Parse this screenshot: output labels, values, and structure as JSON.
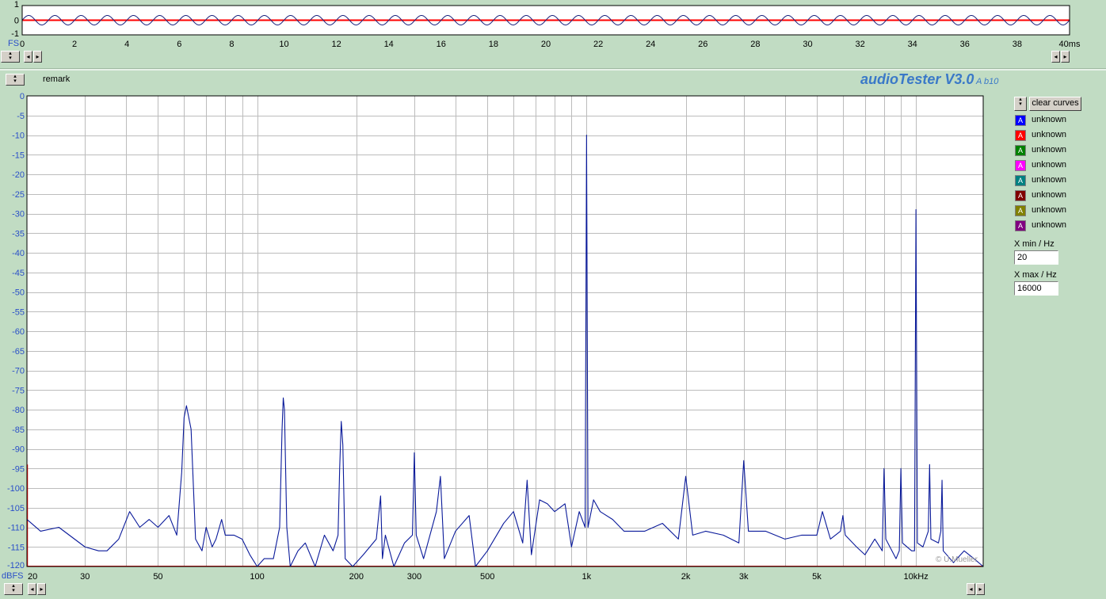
{
  "scope": {
    "y_ticks": [
      "1",
      "0",
      "-1"
    ],
    "y_unit": "FS",
    "x_ticks": [
      "0",
      "2",
      "4",
      "6",
      "8",
      "10",
      "12",
      "14",
      "16",
      "18",
      "20",
      "22",
      "24",
      "26",
      "28",
      "30",
      "32",
      "34",
      "36",
      "38",
      "40ms"
    ],
    "trace_color": "#1a237e",
    "zero_line_color": "#ff0000"
  },
  "header": {
    "remark": "remark",
    "app_title": "audioTester V3.0",
    "app_version": "A b10"
  },
  "spectrum": {
    "y_ticks": [
      "0",
      "-5",
      "-10",
      "-15",
      "-20",
      "-25",
      "-30",
      "-35",
      "-40",
      "-45",
      "-50",
      "-55",
      "-60",
      "-65",
      "-70",
      "-75",
      "-80",
      "-85",
      "-90",
      "-95",
      "-100",
      "-105",
      "-110",
      "-115",
      "-120"
    ],
    "y_unit": "dBFS",
    "x_ticks": [
      "20",
      "30",
      "50",
      "100",
      "200",
      "300",
      "500",
      "1k",
      "2k",
      "3k",
      "5k",
      "10kHz"
    ],
    "copyright": "© U.Mueller",
    "trace_color": "#0a1a9a"
  },
  "chart_data": {
    "type": "line",
    "title": "",
    "xlabel": "",
    "ylabel": "dBFS",
    "x_scale": "log",
    "xlim": [
      20,
      16000
    ],
    "ylim": [
      -120,
      0
    ],
    "grid": true,
    "series": [
      {
        "name": "unknown",
        "color": "#0a1a9a",
        "x": [
          20,
          22,
          25,
          30,
          33,
          35,
          38,
          41,
          44,
          47,
          50,
          54,
          57,
          59,
          60,
          61,
          63,
          65,
          68,
          70,
          73,
          75,
          78,
          80,
          85,
          90,
          95,
          100,
          105,
          112,
          117,
          119,
          120,
          121,
          123,
          126,
          133,
          140,
          150,
          160,
          170,
          176,
          178,
          180,
          182,
          185,
          195,
          210,
          230,
          237,
          240,
          245,
          260,
          280,
          296,
          300,
          304,
          320,
          350,
          360,
          370,
          400,
          440,
          460,
          500,
          560,
          600,
          640,
          660,
          680,
          720,
          760,
          800,
          860,
          900,
          950,
          990,
          1000,
          1010,
          1050,
          1100,
          1200,
          1300,
          1500,
          1700,
          1900,
          2000,
          2100,
          2300,
          2600,
          2900,
          3000,
          3100,
          3500,
          4000,
          4500,
          5000,
          5200,
          5500,
          5900,
          6000,
          6100,
          6600,
          7000,
          7500,
          7900,
          8000,
          8100,
          8700,
          8900,
          9000,
          9100,
          9700,
          9900,
          10000,
          10100,
          10500,
          10900,
          11000,
          11100,
          11700,
          11900,
          12000,
          12100,
          13000,
          14000,
          15000,
          16000
        ],
        "y": [
          -108,
          -111,
          -110,
          -115,
          -116,
          -116,
          -113,
          -106,
          -110,
          -108,
          -110,
          -107,
          -112,
          -96,
          -82,
          -79,
          -85,
          -113,
          -116,
          -110,
          -115,
          -113,
          -108,
          -112,
          -112,
          -113,
          -117,
          -120,
          -118,
          -118,
          -110,
          -85,
          -77,
          -80,
          -110,
          -120,
          -116,
          -114,
          -120,
          -112,
          -116,
          -112,
          -95,
          -83,
          -89,
          -118,
          -120,
          -117,
          -113,
          -102,
          -118,
          -112,
          -120,
          -114,
          -112,
          -91,
          -112,
          -118,
          -106,
          -97,
          -118,
          -111,
          -107,
          -120,
          -116,
          -109,
          -106,
          -114,
          -98,
          -117,
          -103,
          -104,
          -106,
          -104,
          -115,
          -106,
          -110,
          -10,
          -110,
          -103,
          -106,
          -108,
          -111,
          -111,
          -109,
          -113,
          -97,
          -112,
          -111,
          -112,
          -114,
          -93,
          -111,
          -111,
          -113,
          -112,
          -112,
          -106,
          -113,
          -111,
          -107,
          -112,
          -115,
          -117,
          -113,
          -116,
          -95,
          -113,
          -118,
          -116,
          -95,
          -114,
          -116,
          -116,
          -29,
          -114,
          -115,
          -111,
          -94,
          -113,
          -114,
          -111,
          -98,
          -116,
          -119,
          -116,
          -118,
          -120
        ]
      }
    ]
  },
  "legend": {
    "clear_label": "clear curves",
    "items": [
      {
        "label": "unknown",
        "color": "#0000ff"
      },
      {
        "label": "unknown",
        "color": "#ff0000"
      },
      {
        "label": "unknown",
        "color": "#008000"
      },
      {
        "label": "unknown",
        "color": "#ff00ff"
      },
      {
        "label": "unknown",
        "color": "#008080"
      },
      {
        "label": "unknown",
        "color": "#800000"
      },
      {
        "label": "unknown",
        "color": "#808000"
      },
      {
        "label": "unknown",
        "color": "#800080"
      }
    ],
    "xmin_label": "X min / Hz",
    "xmin_value": "20",
    "xmax_label": "X max / Hz",
    "xmax_value": "16000"
  },
  "icons": {
    "spin": "spin-updown-icon",
    "left": "arrow-left-icon",
    "right": "arrow-right-icon"
  }
}
